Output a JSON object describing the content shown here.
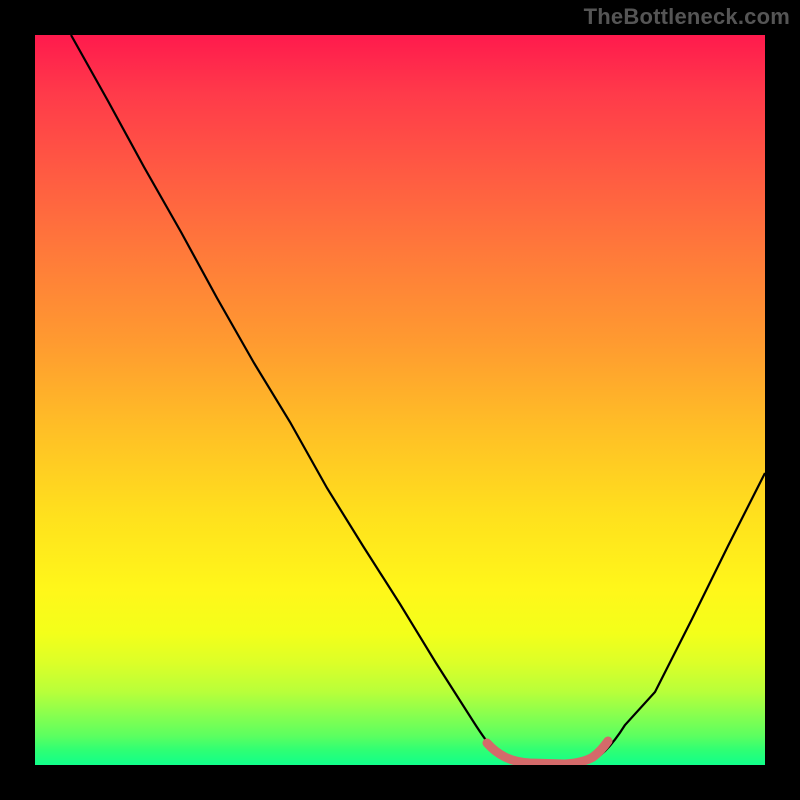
{
  "watermark": "TheBottleneck.com",
  "chart_data": {
    "type": "line",
    "title": "",
    "xlabel": "",
    "ylabel": "",
    "xlim": [
      0,
      100
    ],
    "ylim": [
      0,
      100
    ],
    "grid": false,
    "legend": false,
    "series": [
      {
        "name": "bottleneck-curve",
        "color": "#000000",
        "x": [
          5,
          10,
          15,
          20,
          25,
          30,
          35,
          40,
          45,
          50,
          55,
          60,
          62,
          65,
          70,
          75,
          78,
          80,
          85,
          90,
          95,
          100
        ],
        "y": [
          100,
          91,
          82,
          73,
          64,
          55,
          47,
          38,
          30,
          22,
          14,
          6,
          3,
          1,
          0,
          0,
          1,
          3,
          10,
          20,
          30,
          40
        ]
      },
      {
        "name": "optimal-zone-highlight",
        "color": "#d46a6a",
        "x": [
          62,
          65,
          70,
          75,
          78
        ],
        "y": [
          3,
          1,
          0,
          0,
          1
        ]
      }
    ],
    "background_gradient": {
      "top_color": "#ff1a4d",
      "mid_color": "#ffe11d",
      "bottom_color": "#11ff8a"
    }
  }
}
